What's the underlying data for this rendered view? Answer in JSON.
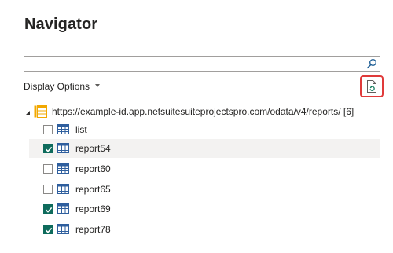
{
  "header": {
    "title": "Navigator"
  },
  "search": {
    "value": "",
    "placeholder": ""
  },
  "toolbar": {
    "display_options_label": "Display Options"
  },
  "tree": {
    "root_label": "https://example-id.app.netsuitesuiteprojectspro.com/odata/v4/reports/ [6]",
    "items": [
      {
        "label": "list",
        "checked": false,
        "selected": false
      },
      {
        "label": "report54",
        "checked": true,
        "selected": true
      },
      {
        "label": "report60",
        "checked": false,
        "selected": false
      },
      {
        "label": "report65",
        "checked": false,
        "selected": false
      },
      {
        "label": "report69",
        "checked": true,
        "selected": false
      },
      {
        "label": "report78",
        "checked": true,
        "selected": false
      }
    ]
  },
  "colors": {
    "checkbox_checked": "#0e6b5c",
    "refresh_highlight": "#e03a3a",
    "root_icon": "#f2a800"
  },
  "icons": {
    "search": "search-icon",
    "refresh": "refresh-document-icon",
    "root": "folder-table-icon",
    "table": "table-icon"
  }
}
